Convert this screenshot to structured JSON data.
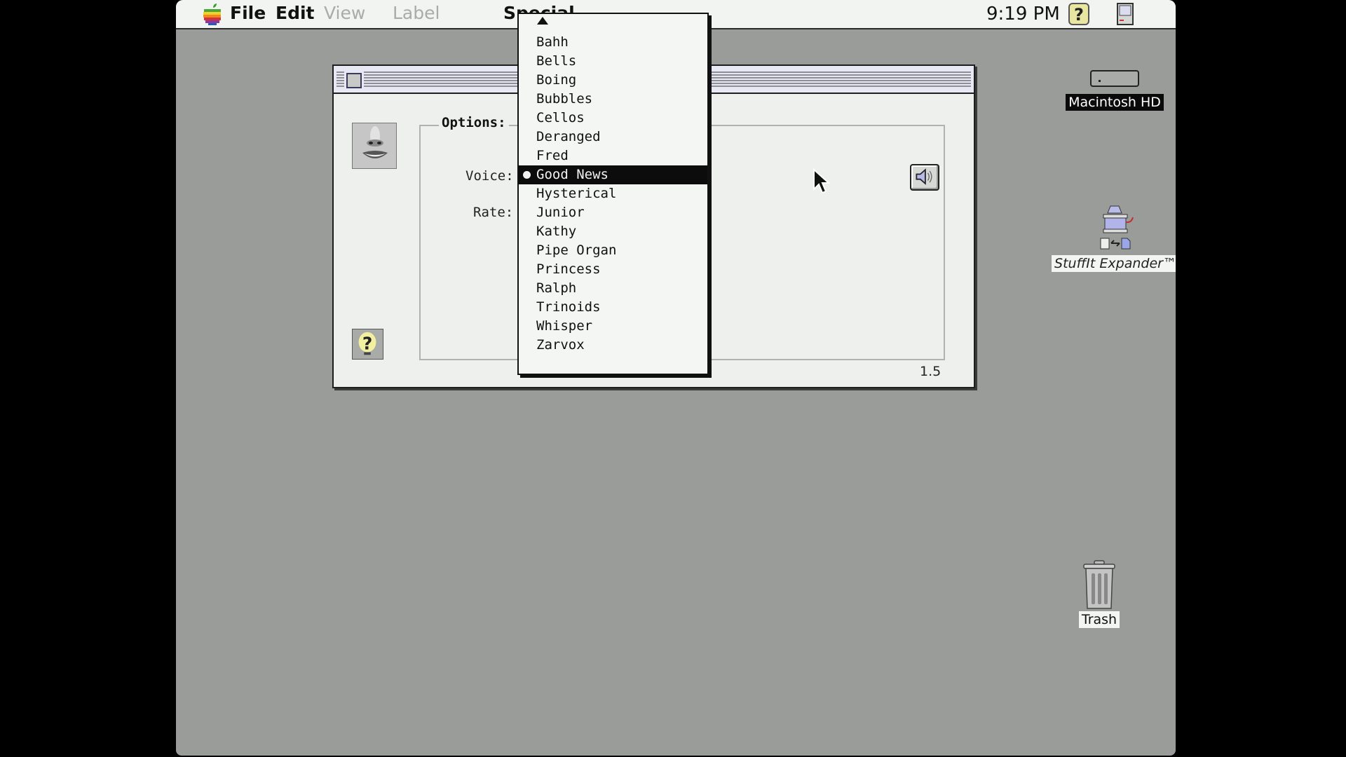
{
  "menubar": {
    "apple_icon": "rainbow-apple-icon",
    "items": [
      {
        "label": "File",
        "enabled": true
      },
      {
        "label": "Edit",
        "enabled": true
      },
      {
        "label": "View",
        "enabled": false
      },
      {
        "label": "Label",
        "enabled": false
      },
      {
        "label": "Special",
        "enabled": true
      }
    ],
    "clock": "9:19 PM",
    "help_icon": "balloon-help-icon",
    "app_icon": "finder-mac-icon"
  },
  "window": {
    "title": "",
    "options_label": "Options:",
    "voice_label": "Voice:",
    "rate_label": "Rate:",
    "version": "1.5",
    "speaker_button_icon": "speaker-icon",
    "help_button_icon": "help-question-icon"
  },
  "voice_popup": {
    "selected": "Good News",
    "items": [
      "Bahh",
      "Bells",
      "Boing",
      "Bubbles",
      "Cellos",
      "Deranged",
      "Fred",
      "Good News",
      "Hysterical",
      "Junior",
      "Kathy",
      "Pipe Organ",
      "Princess",
      "Ralph",
      "Trinoids",
      "Whisper",
      "Zarvox"
    ]
  },
  "desktop": {
    "icons": [
      {
        "label": "Macintosh HD",
        "icon": "hard-disk-icon",
        "selected": true
      },
      {
        "label": "StuffIt Expander™",
        "icon": "stuffit-expander-icon",
        "selected": false
      },
      {
        "label": "Trash",
        "icon": "trash-icon",
        "selected": false
      }
    ]
  },
  "colors": {
    "desktop": "#9a9c99",
    "menubar": "#f1f4f1",
    "selection": "#0c0c0c"
  }
}
